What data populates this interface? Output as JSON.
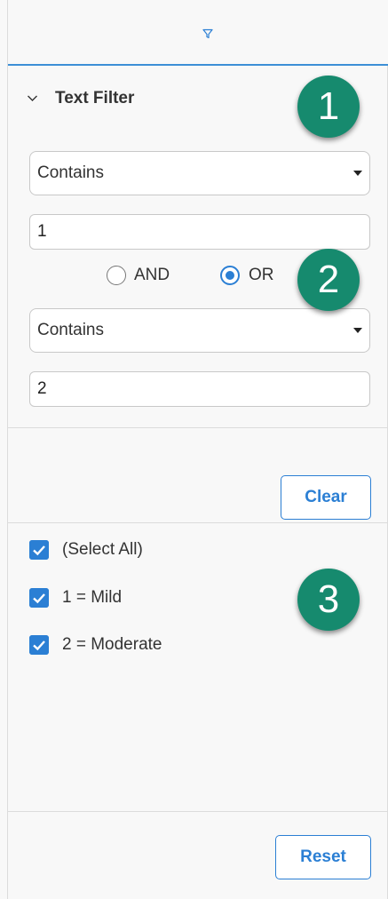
{
  "header": {
    "icon": "funnel-icon"
  },
  "text_filter": {
    "title": "Text Filter",
    "condition1": {
      "operator": "Contains",
      "value": "1"
    },
    "join": {
      "options": [
        "AND",
        "OR"
      ],
      "selected": "OR"
    },
    "condition2": {
      "operator": "Contains",
      "value": "2"
    },
    "clear_label": "Clear"
  },
  "set_filter": {
    "items": [
      {
        "label": "(Select All)",
        "checked": true
      },
      {
        "label": "1 = Mild",
        "checked": true
      },
      {
        "label": "2 = Moderate",
        "checked": true
      }
    ],
    "reset_label": "Reset"
  },
  "callouts": [
    "1",
    "2",
    "3"
  ],
  "colors": {
    "accent": "#2b7fd4",
    "badge": "#168a6e"
  }
}
